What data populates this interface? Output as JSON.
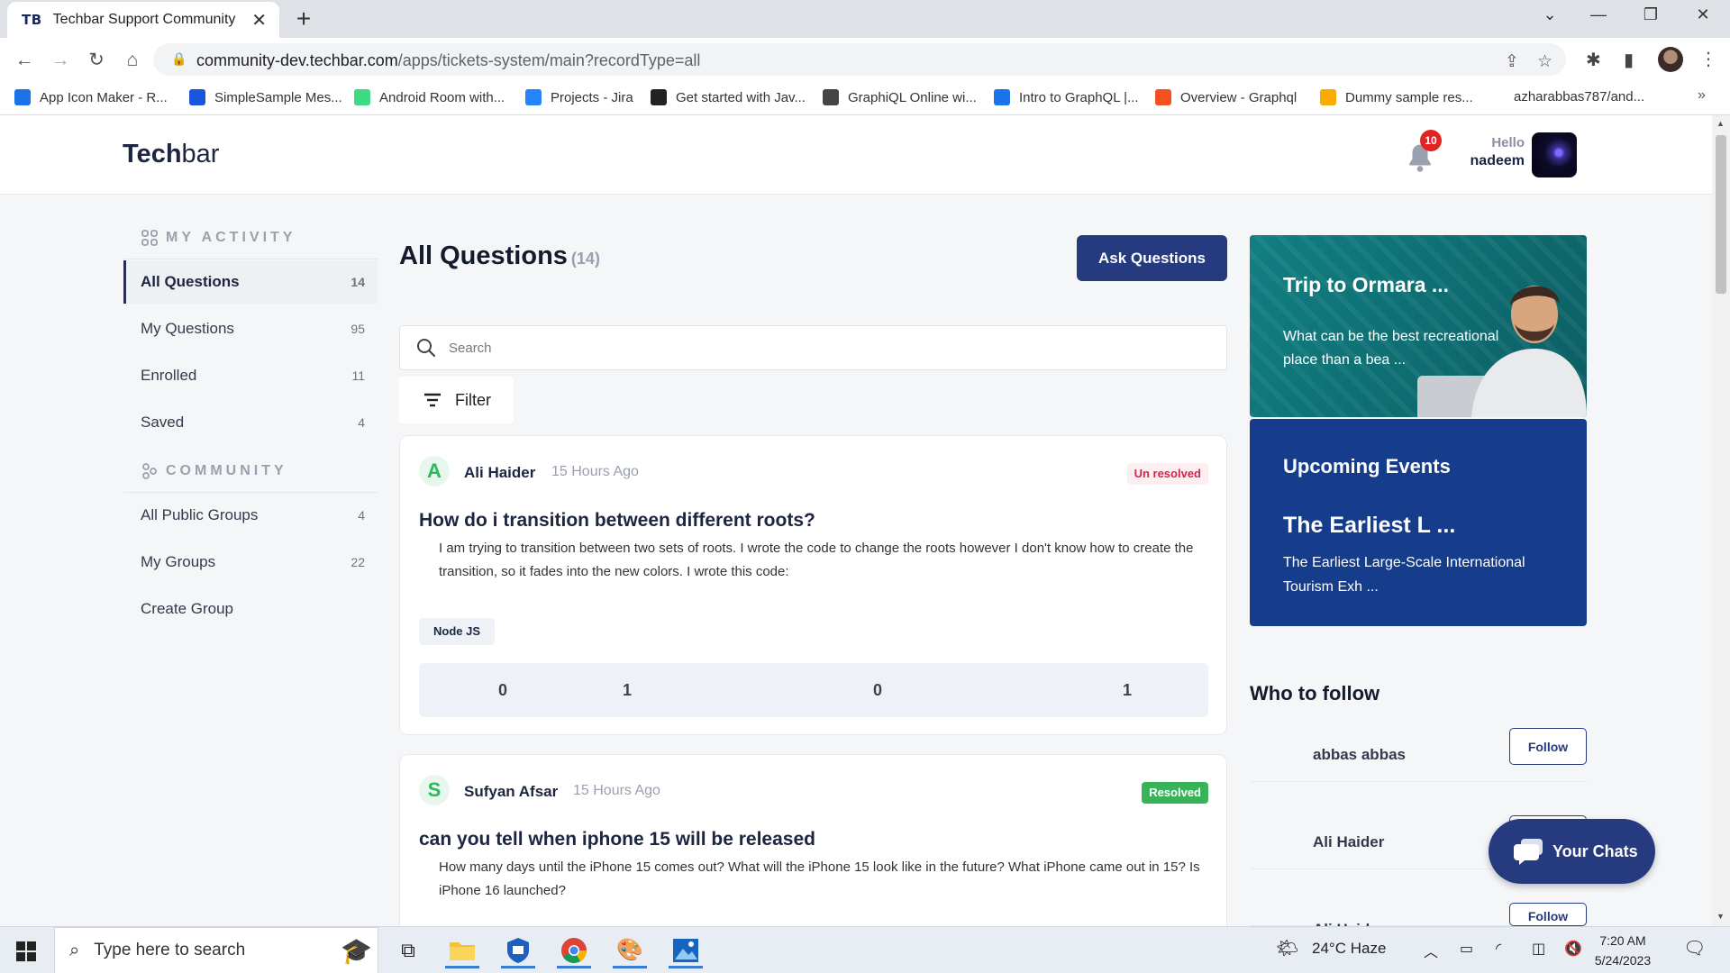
{
  "browser": {
    "tab_favicon": "TB",
    "tab_title": "Techbar Support Community",
    "url_host": "community-dev.techbar.com",
    "url_path": "/apps/tickets-system/main?recordType=all",
    "bookmarks": [
      {
        "label": "App Icon Maker - R...",
        "icon": "app-icon",
        "color": "#1a73e8"
      },
      {
        "label": "SimpleSample Mes...",
        "icon": "grid-icon",
        "color": "#1a56db"
      },
      {
        "label": "Android Room with...",
        "icon": "android-icon",
        "color": "#3ddc84"
      },
      {
        "label": "Projects - Jira",
        "icon": "jira-icon",
        "color": "#2684ff"
      },
      {
        "label": "Get started with Jav...",
        "icon": "a-icon",
        "color": "#222222"
      },
      {
        "label": "GraphiQL Online wi...",
        "icon": "globe-icon",
        "color": "#444444"
      },
      {
        "label": "Intro to GraphQL |...",
        "icon": "clock-icon",
        "color": "#1a73e8"
      },
      {
        "label": "Overview - Graphql",
        "icon": "flame-icon",
        "color": "#f4511e"
      },
      {
        "label": "Dummy sample res...",
        "icon": "doc-icon",
        "color": "#f9ab00"
      },
      {
        "label": "azharabbas787/and...",
        "icon": "",
        "color": ""
      }
    ]
  },
  "header": {
    "logo_bold": "Tech",
    "logo_light": "bar",
    "notification_count": "10",
    "greeting": "Hello",
    "username": "nadeem"
  },
  "sidebar": {
    "activity_heading": "MY ACTIVITY",
    "activity_items": [
      {
        "label": "All Questions",
        "count": "14",
        "active": true
      },
      {
        "label": "My Questions",
        "count": "95"
      },
      {
        "label": "Enrolled",
        "count": "11"
      },
      {
        "label": "Saved",
        "count": "4"
      }
    ],
    "community_heading": "COMMUNITY",
    "community_items": [
      {
        "label": "All Public Groups",
        "count": "4"
      },
      {
        "label": "My Groups",
        "count": "22"
      },
      {
        "label": "Create Group",
        "count": ""
      }
    ]
  },
  "main": {
    "title": "All Questions",
    "count": "(14)",
    "ask_label": "Ask Questions",
    "search_placeholder": "Search",
    "filter_label": "Filter",
    "questions": [
      {
        "initial": "A",
        "author": "Ali Haider",
        "time": "15 Hours Ago",
        "status": "Un resolved",
        "title": "How do i transition between different roots?",
        "body": "I am trying to transition between two sets of roots. I wrote the code to change the roots however I don't know how to create the transition, so it fades into the new colors. I wrote this code:",
        "tag": "Node JS",
        "stats": [
          "0",
          "1",
          "0",
          "1"
        ]
      },
      {
        "initial": "S",
        "author": "Sufyan Afsar",
        "time": "15 Hours Ago",
        "status": "Resolved",
        "title": "can you tell when iphone 15 will be released",
        "body": "How many days until the iPhone 15 comes out? What will the iPhone 15 look like in the future? What iPhone came out in 15? Is iPhone 16 launched?"
      }
    ]
  },
  "right": {
    "promo_title": "Trip to Ormara ...",
    "promo_desc": "What can be the best recreational place than a bea ...",
    "events_heading": "Upcoming Events",
    "event_name": "The Earliest L ...",
    "event_desc": "The Earliest Large-Scale International Tourism Exh ...",
    "who_to_follow": "Who to follow",
    "follow_label": "Follow",
    "people": [
      "abbas abbas",
      "Ali Haider",
      "Ali Haider"
    ],
    "chats_label": "Your Chats"
  },
  "taskbar": {
    "search_placeholder": "Type here to search",
    "weather": "24°C  Haze",
    "time": "7:20 AM",
    "date": "5/24/2023"
  },
  "colors": {
    "primary": "#263a80",
    "unresolved": "#d6244a",
    "resolved": "#38b35a",
    "events_bg": "#163c8c",
    "promo_bg": "#0f6e73"
  }
}
